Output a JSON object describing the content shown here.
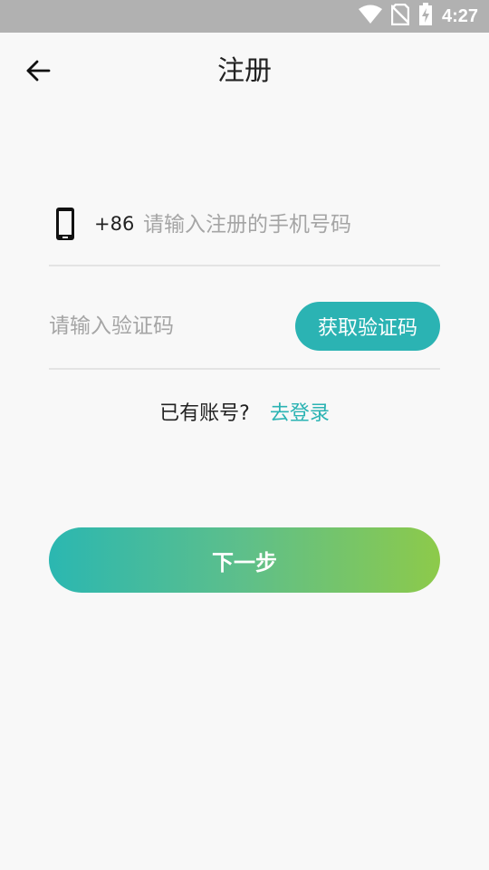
{
  "status_bar": {
    "time": "4:27",
    "icons": [
      "wifi-icon",
      "no-sim-icon",
      "battery-charging-icon"
    ]
  },
  "header": {
    "title": "注册",
    "back_icon": "arrow-left-icon"
  },
  "form": {
    "phone": {
      "icon": "smartphone-icon",
      "country_code": "+86",
      "placeholder": "请输入注册的手机号码",
      "value": ""
    },
    "code": {
      "placeholder": "请输入验证码",
      "value": "",
      "get_code_label": "获取验证码"
    }
  },
  "login_prompt": {
    "text": "已有账号?",
    "link_label": "去登录"
  },
  "next_button": {
    "label": "下一步"
  },
  "colors": {
    "accent": "#2bb3b3",
    "gradient_start": "#2bb7b1",
    "gradient_end": "#8dca4a",
    "background": "#f8f8f8",
    "status_bar": "#b1b1b1"
  }
}
